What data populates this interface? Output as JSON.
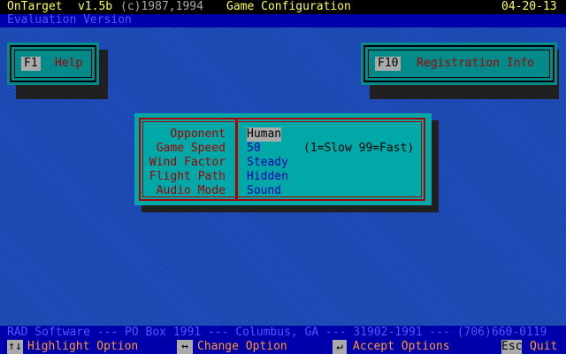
{
  "titlebar": {
    "app_name": "OnTarget",
    "version": "v1.5b",
    "copyright": "(c)1987,1994",
    "screen_title": "Game Configuration",
    "date": "04-20-13"
  },
  "eval_text": "Evaluation Version",
  "hotkeys": {
    "help": {
      "key": "F1",
      "label": "Help"
    },
    "registration": {
      "key": "F10",
      "label": "Registration Info"
    }
  },
  "options": [
    {
      "label": "Opponent",
      "value": "Human"
    },
    {
      "label": "Game Speed",
      "value": "50"
    },
    {
      "label": "Wind Factor",
      "value": "Steady"
    },
    {
      "label": "Flight Path",
      "value": "Hidden"
    },
    {
      "label": "Audio Mode",
      "value": "Sound"
    }
  ],
  "speed_hint": "(1=Slow 99=Fast)",
  "footer_info": "RAD Software --- PO Box 1991 --- Columbus, GA --- 31902-1991 --- (706)660-0119",
  "footer_actions": {
    "highlight": {
      "key": "↑↓",
      "label": "Highlight Option"
    },
    "change": {
      "key": "↔",
      "label": "Change Option"
    },
    "accept": {
      "key": "↵",
      "label": "Accept Options"
    },
    "quit": {
      "key": "Esc",
      "label": "Quit"
    }
  },
  "colors": {
    "desktop": "#1f4fbf",
    "dialog": "#00a8a8",
    "frame": "#aa0000",
    "title_text": "#ffff55",
    "footer_label": "#ff9933"
  }
}
